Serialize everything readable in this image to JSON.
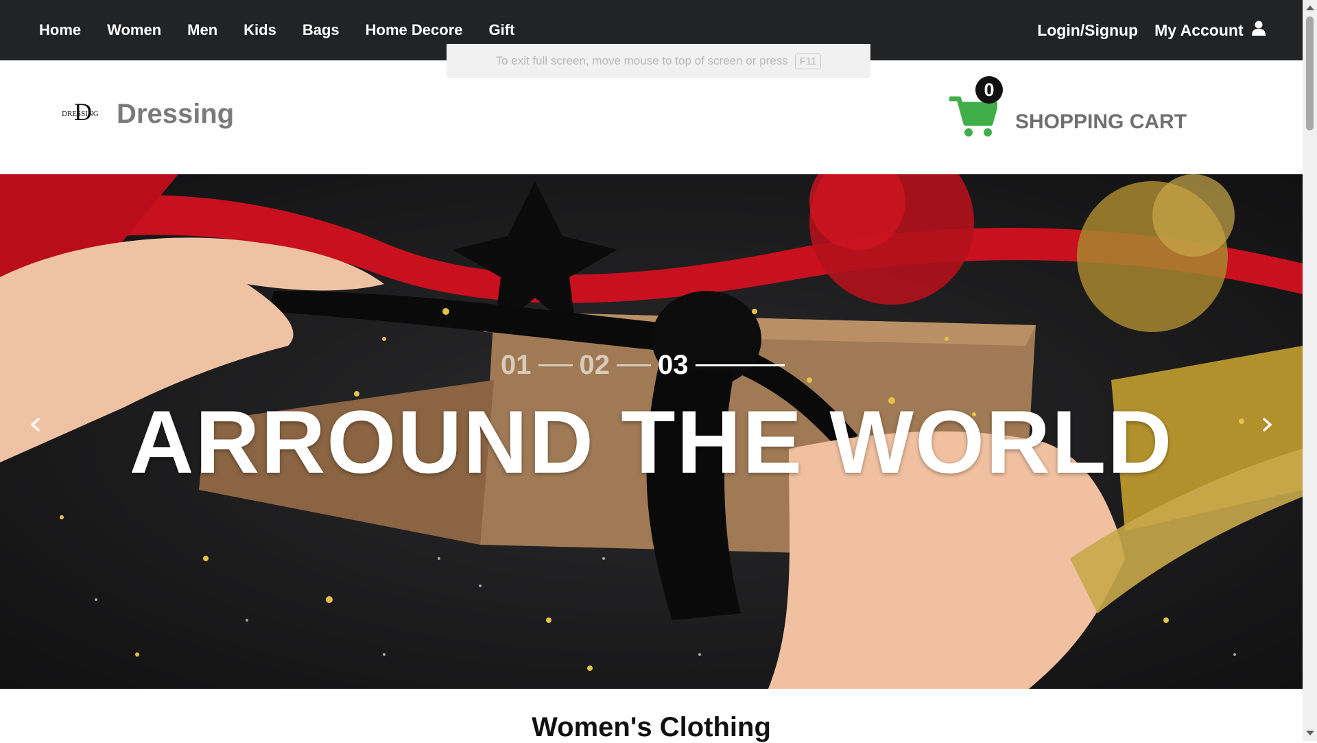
{
  "nav": {
    "links": [
      "Home",
      "Women",
      "Men",
      "Kids",
      "Bags",
      "Home Decore",
      "Gift"
    ],
    "login_label": "Login/Signup",
    "account_label": "My Account",
    "account_icon": "user-icon"
  },
  "fullscreen_toast": {
    "text": "To exit full screen, move mouse to top of screen or press",
    "key": "F11"
  },
  "header": {
    "logo_text_small": "DRESSING",
    "logo_letter": "D",
    "brand": "Dressing",
    "cart_count": "0",
    "cart_label": "SHOPPING CART",
    "cart_icon": "cart-icon",
    "cart_color": "#3fae49"
  },
  "hero": {
    "slides": [
      "01",
      "02",
      "03"
    ],
    "active_slide": "03",
    "title": "ARROUND THE WORLD",
    "prev_icon": "chevron-left-icon",
    "next_icon": "chevron-right-icon",
    "background": "gift wrapping photo with red and black ribbons"
  },
  "section": {
    "title": "Women's Clothing"
  }
}
